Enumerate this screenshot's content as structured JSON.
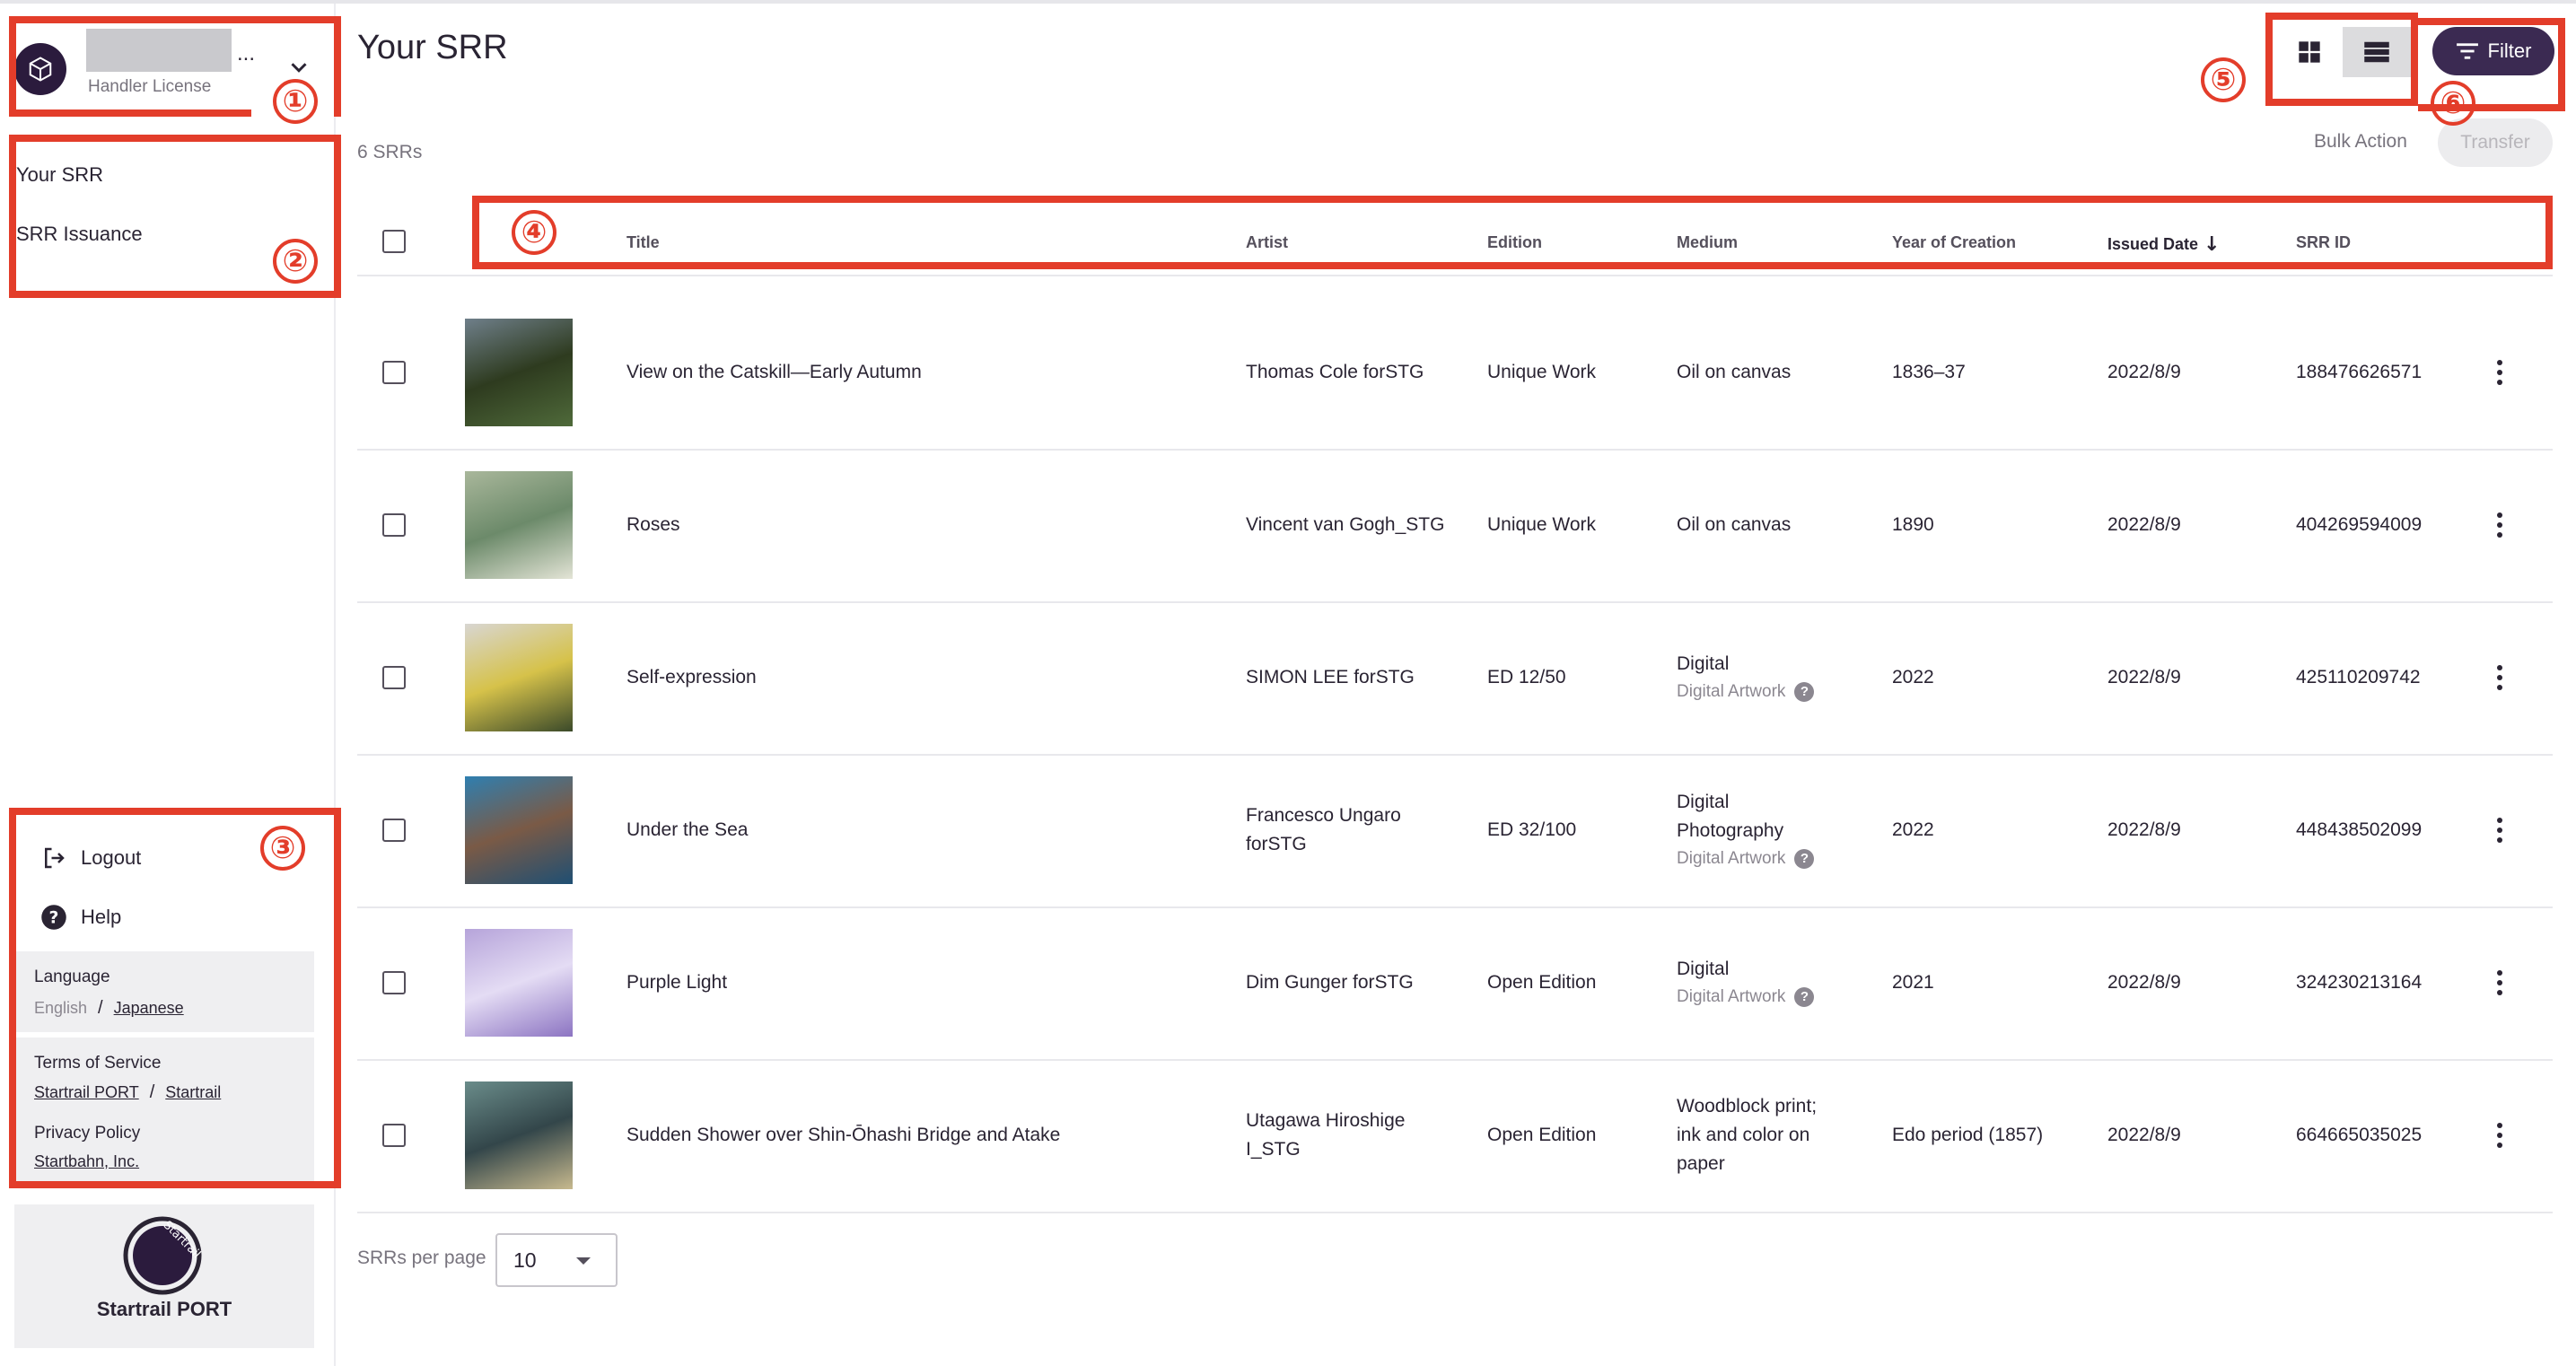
{
  "account": {
    "name_suffix": "...",
    "license": "Handler License"
  },
  "nav": {
    "items": [
      {
        "label": "Your SRR"
      },
      {
        "label": "SRR Issuance"
      }
    ]
  },
  "sidebar_footer": {
    "logout": "Logout",
    "help": "Help",
    "language_label": "Language",
    "language_current": "English",
    "language_separator": "/",
    "language_alt": "Japanese",
    "terms_label": "Terms of Service",
    "terms_link_1": "Startrail PORT",
    "terms_separator": "/",
    "terms_link_2": "Startrail",
    "privacy_label": "Privacy Policy",
    "privacy_link": "Startbahn, Inc.",
    "brand_name": "Startrail PORT",
    "brand_logo_text": "Startrail"
  },
  "annotations": [
    "①",
    "②",
    "③",
    "④",
    "⑤",
    "⑥"
  ],
  "main": {
    "title": "Your SRR",
    "count": "6 SRRs",
    "filter_label": "Filter",
    "bulk_action_label": "Bulk Action",
    "transfer_label": "Transfer",
    "columns": {
      "title": "Title",
      "artist": "Artist",
      "edition": "Edition",
      "medium": "Medium",
      "year": "Year of Creation",
      "issued": "Issued Date",
      "srr_id": "SRR ID"
    },
    "sort_indicator": "↓",
    "rows": [
      {
        "title": "View on the Catskill—Early Autumn",
        "artist_line1": "Thomas Cole forSTG",
        "artist_line2": "",
        "edition": "Unique Work",
        "medium_lines": [
          "Oil on canvas"
        ],
        "medium_sub": "",
        "year": "1836–37",
        "issued": "2022/8/9",
        "srr_id": "188476626571",
        "thumb_colors": [
          "#6f7f8a",
          "#4f6a3a",
          "#2e3b1f"
        ]
      },
      {
        "title": "Roses",
        "artist_line1": "Vincent van Gogh_STG",
        "artist_line2": "",
        "edition": "Unique Work",
        "medium_lines": [
          "Oil on canvas"
        ],
        "medium_sub": "",
        "year": "1890",
        "issued": "2022/8/9",
        "srr_id": "404269594009",
        "thumb_colors": [
          "#a9b79b",
          "#e3e4d6",
          "#6c8a6a"
        ]
      },
      {
        "title": "Self-expression",
        "artist_line1": "SIMON LEE forSTG",
        "artist_line2": "",
        "edition": "ED 12/50",
        "medium_lines": [
          "Digital"
        ],
        "medium_sub": "Digital Artwork",
        "year": "2022",
        "issued": "2022/8/9",
        "srr_id": "425110209742",
        "thumb_colors": [
          "#d8d6d2",
          "#3b4a2a",
          "#d6c24a"
        ]
      },
      {
        "title": "Under the Sea",
        "artist_line1": "Francesco Ungaro",
        "artist_line2": "forSTG",
        "edition": "ED 32/100",
        "medium_lines": [
          "Digital",
          "Photography"
        ],
        "medium_sub": "Digital Artwork",
        "year": "2022",
        "issued": "2022/8/9",
        "srr_id": "448438502099",
        "thumb_colors": [
          "#2f7fb0",
          "#1f4f73",
          "#7a5a46"
        ]
      },
      {
        "title": "Purple Light",
        "artist_line1": "Dim Gunger forSTG",
        "artist_line2": "",
        "edition": "Open Edition",
        "medium_lines": [
          "Digital"
        ],
        "medium_sub": "Digital Artwork",
        "year": "2021",
        "issued": "2022/8/9",
        "srr_id": "324230213164",
        "thumb_colors": [
          "#b6a4da",
          "#8c74c2",
          "#e4dcf4"
        ]
      },
      {
        "title": "Sudden Shower over Shin-Ōhashi Bridge and Atake",
        "artist_line1": "Utagawa Hiroshige",
        "artist_line2": "I_STG",
        "edition": "Open Edition",
        "medium_lines": [
          "Woodblock print;",
          "ink and color on",
          "paper"
        ],
        "medium_sub": "",
        "year": "Edo period (1857)",
        "issued": "2022/8/9",
        "srr_id": "664665035025",
        "thumb_colors": [
          "#6a8c8a",
          "#c7b98e",
          "#33464a"
        ]
      }
    ],
    "per_page_label": "SRRs per page",
    "per_page_value": "10"
  },
  "colors": {
    "annotation": "#e33d2a",
    "primary": "#3b2a52",
    "text": "#2a2433",
    "muted": "#77737d"
  }
}
